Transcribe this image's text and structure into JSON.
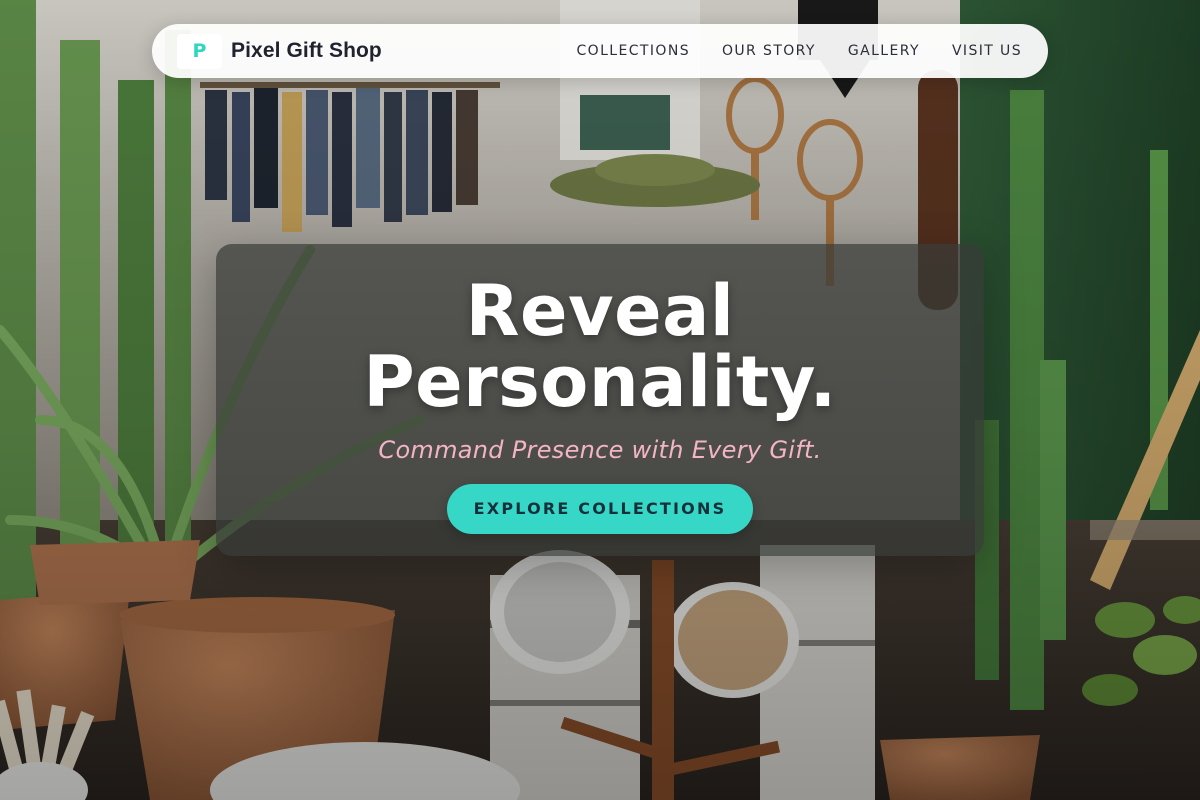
{
  "brand": {
    "logo_letter": "P",
    "name": "Pixel Gift Shop"
  },
  "nav": {
    "links": [
      {
        "label": "COLLECTIONS"
      },
      {
        "label": "OUR STORY"
      },
      {
        "label": "GALLERY"
      },
      {
        "label": "VISIT US"
      }
    ]
  },
  "hero": {
    "headline_line1": "Reveal",
    "headline_line2": "Personality.",
    "tagline": "Command Presence with Every Gift.",
    "cta_label": "EXPLORE COLLECTIONS"
  },
  "colors": {
    "accent": "#36d7c6",
    "tagline_pink": "#f4b4c8",
    "brand_text": "#1f2330"
  }
}
